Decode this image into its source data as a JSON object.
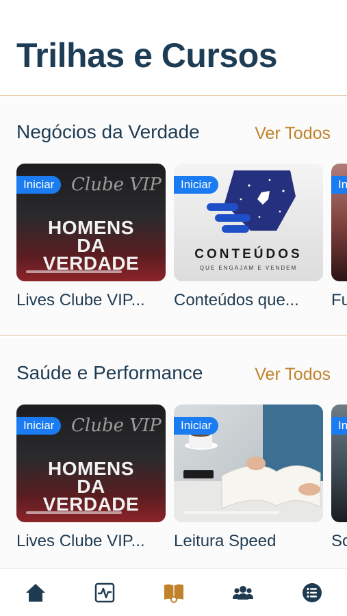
{
  "page": {
    "title": "Trilhas e Cursos"
  },
  "colors": {
    "accent": "#c0822a",
    "badge": "#1a7cf0",
    "text": "#1f3b52",
    "divider": "#e7cfae"
  },
  "sections": [
    {
      "title": "Negócios da Verdade",
      "see_all": "Ver Todos",
      "cards": [
        {
          "badge": "Iniciar",
          "title": "Lives Clube VIP...",
          "thumb": {
            "script": "Clube VIP",
            "line1": "HOMENS",
            "line2": "DA",
            "line3": "VERDADE"
          }
        },
        {
          "badge": "Iniciar",
          "title": "Conteúdos que...",
          "thumb": {
            "word": "CONTEÚDOS",
            "sub": "QUE ENGAJAM E VENDEM"
          }
        },
        {
          "badge": "Ini",
          "title": "Fu"
        }
      ]
    },
    {
      "title": "Saúde e Performance",
      "see_all": "Ver Todos",
      "cards": [
        {
          "badge": "Iniciar",
          "title": "Lives Clube VIP...",
          "thumb": {
            "script": "Clube VIP",
            "line1": "HOMENS",
            "line2": "DA",
            "line3": "VERDADE"
          }
        },
        {
          "badge": "Iniciar",
          "title": "Leitura Speed"
        },
        {
          "badge": "In",
          "title": "So"
        }
      ]
    }
  ],
  "tabbar": {
    "items": [
      {
        "icon": "home-icon",
        "active": false
      },
      {
        "icon": "activity-monitor-icon",
        "active": false
      },
      {
        "icon": "courses-book-icon",
        "active": true
      },
      {
        "icon": "community-group-icon",
        "active": false
      },
      {
        "icon": "menu-list-icon",
        "active": false
      }
    ],
    "active_color": "#c0822a",
    "inactive_color": "#1f3b52"
  }
}
